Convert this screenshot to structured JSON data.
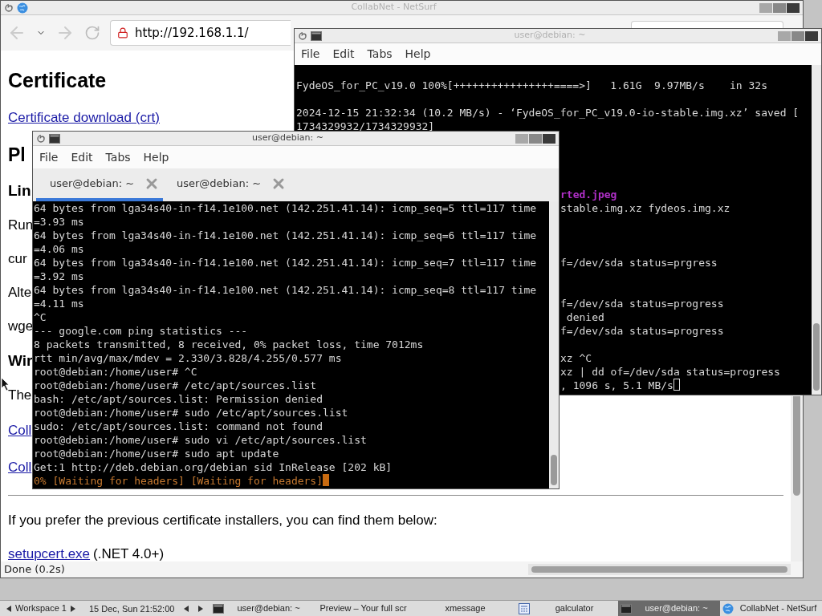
{
  "browser": {
    "title": "CollabNet - NetSurf",
    "active": false,
    "url": "http://192.168.1.1/",
    "status": "Done (0.2s)",
    "page": [
      {
        "kind": "h1",
        "text": "Certificate"
      },
      {
        "kind": "link",
        "text": "Certificate download (crt)"
      },
      {
        "kind": "h2",
        "text": "Pl"
      },
      {
        "kind": "h3",
        "text": "Lin"
      },
      {
        "kind": "p",
        "text": "Run"
      },
      {
        "kind": "p",
        "text": "cur"
      },
      {
        "kind": "p",
        "text": "Alte"
      },
      {
        "kind": "p",
        "text": "wge"
      },
      {
        "kind": "h3",
        "text": "Wir"
      },
      {
        "kind": "p",
        "text": "The"
      },
      {
        "kind": "link",
        "text": "Coll"
      },
      {
        "kind": "link",
        "text": "Coll"
      },
      {
        "kind": "hr"
      },
      {
        "kind": "p",
        "text": "If you prefer the previous certificate installers, you can find them below:"
      },
      {
        "kind": "link_note",
        "text": "setupcert.exe",
        "note": "(.NET 4.0+)"
      }
    ]
  },
  "terminal_back": {
    "title": "user@debian: ~",
    "active": false,
    "menu": [
      "File",
      "Edit",
      "Tabs",
      "Help"
    ],
    "lines": [
      {
        "kind": "blank"
      },
      {
        "kind": "full",
        "text": "FydeOS_for_PC_v19.0 100%[++++++++++++++++====>]   1.61G  9.97MB/s    in 32s"
      },
      {
        "kind": "blank"
      },
      {
        "kind": "full",
        "text": "2024-12-15 21:32:34 (10.2 MB/s) - ‘FydeOS_for_PC_v19.0-io-stable.img.xz’ saved ["
      },
      {
        "kind": "full",
        "text": "1734329932/1734329932]"
      },
      {
        "kind": "blank"
      },
      {
        "kind": "blank"
      },
      {
        "kind": "blank"
      },
      {
        "kind": "blank"
      },
      {
        "kind": "partial_file",
        "text": "rted.jpeg"
      },
      {
        "kind": "partial",
        "text": "stable.img.xz fydeos.img.xz"
      },
      {
        "kind": "blank"
      },
      {
        "kind": "blank"
      },
      {
        "kind": "blank"
      },
      {
        "kind": "partial",
        "text": "f=/dev/sda status=prgress"
      },
      {
        "kind": "blank"
      },
      {
        "kind": "blank"
      },
      {
        "kind": "partial",
        "text": "f=/dev/sda status=progress"
      },
      {
        "kind": "partial",
        "text": " denied"
      },
      {
        "kind": "partial",
        "text": "f=/dev/sda status=progress"
      },
      {
        "kind": "blank"
      },
      {
        "kind": "partial",
        "text": "xz ^C"
      },
      {
        "kind": "partial",
        "text": "xz | dd of=/dev/sda status=progress"
      },
      {
        "kind": "partial",
        "text": ", 1096 s, 5.1 MB/s"
      }
    ]
  },
  "terminal_front": {
    "title": "user@debian: ~",
    "active": true,
    "menu": [
      "File",
      "Edit",
      "Tabs",
      "Help"
    ],
    "tabs": [
      {
        "label": "user@debian: ~",
        "selected": true
      },
      {
        "label": "user@debian: ~",
        "selected": false
      }
    ],
    "lines": [
      {
        "kind": "out",
        "text": "64 bytes from lga34s40-in-f14.1e100.net (142.251.41.14): icmp_seq=5 ttl=117 time"
      },
      {
        "kind": "out",
        "text": "=3.93 ms"
      },
      {
        "kind": "out",
        "text": "64 bytes from lga34s40-in-f14.1e100.net (142.251.41.14): icmp_seq=6 ttl=117 time"
      },
      {
        "kind": "out",
        "text": "=4.06 ms"
      },
      {
        "kind": "out",
        "text": "64 bytes from lga34s40-in-f14.1e100.net (142.251.41.14): icmp_seq=7 ttl=117 time"
      },
      {
        "kind": "out",
        "text": "=3.92 ms"
      },
      {
        "kind": "out",
        "text": "64 bytes from lga34s40-in-f14.1e100.net (142.251.41.14): icmp_seq=8 ttl=117 time"
      },
      {
        "kind": "out",
        "text": "=4.11 ms"
      },
      {
        "kind": "out",
        "text": "^C"
      },
      {
        "kind": "out",
        "text": "--- google.com ping statistics ---"
      },
      {
        "kind": "out",
        "text": "8 packets transmitted, 8 received, 0% packet loss, time 7012ms"
      },
      {
        "kind": "out",
        "text": "rtt min/avg/max/mdev = 2.330/3.828/4.255/0.577 ms"
      },
      {
        "kind": "out",
        "text": "root@debian:/home/user# ^C"
      },
      {
        "kind": "out",
        "text": "root@debian:/home/user# /etc/apt/sources.list"
      },
      {
        "kind": "out",
        "text": "bash: /etc/apt/sources.list: Permission denied"
      },
      {
        "kind": "out",
        "text": "root@debian:/home/user# sudo /etc/apt/sources.list"
      },
      {
        "kind": "out",
        "text": "sudo: /etc/apt/sources.list: command not found"
      },
      {
        "kind": "out",
        "text": "root@debian:/home/user# sudo vi /etc/apt/sources.list"
      },
      {
        "kind": "out",
        "text": "root@debian:/home/user# sudo apt update"
      },
      {
        "kind": "out",
        "text": "Get:1 http://deb.debian.org/debian sid InRelease [202 kB]"
      },
      {
        "kind": "progress",
        "text": "0% [Waiting for headers] [Waiting for headers]"
      }
    ]
  },
  "taskbar": {
    "workspace": "Workspace 1",
    "clock": "15 Dec, Sun 21:52:00",
    "tasks": [
      {
        "kind": "terminal",
        "label": "user@debian: ~",
        "selected": false
      },
      {
        "kind": "plain",
        "label": "Preview – Your full scr",
        "selected": false
      },
      {
        "kind": "plain",
        "label": "xmessage",
        "selected": false
      },
      {
        "kind": "calculator",
        "label": "galculator",
        "selected": false
      },
      {
        "kind": "terminal",
        "label": "user@debian: ~",
        "selected": true
      },
      {
        "kind": "browser",
        "label": "CollabNet - NetSurf",
        "selected": false
      }
    ]
  }
}
